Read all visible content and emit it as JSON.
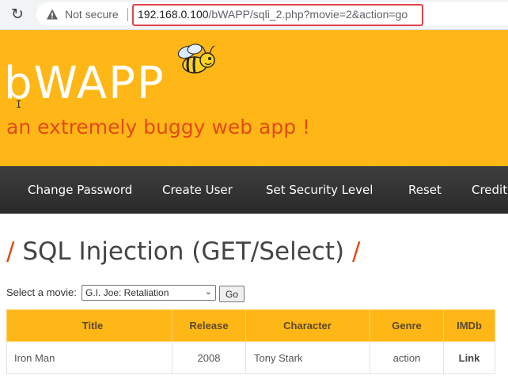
{
  "browser": {
    "not_secure": "Not secure",
    "url_host": "192.168.0.100",
    "url_path": "/bWAPP/sqli_2.php?movie=2&action=go"
  },
  "header": {
    "logo": "bWAPP",
    "tagline": "an extremely buggy web app !"
  },
  "nav": {
    "items": [
      "Change Password",
      "Create User",
      "Set Security Level",
      "Reset",
      "Credit"
    ]
  },
  "page": {
    "title": "SQL Injection (GET/Select)",
    "select_label": "Select a movie:",
    "selected_movie": "G.I. Joe: Retaliation",
    "go_label": "Go"
  },
  "table": {
    "headers": [
      "Title",
      "Release",
      "Character",
      "Genre",
      "IMDb"
    ],
    "rows": [
      [
        "Iron Man",
        "2008",
        "Tony Stark",
        "action",
        "Link"
      ]
    ]
  },
  "colors": {
    "header_bg": "#ffb717",
    "accent": "#e24a14",
    "nav_bg": "#2f2f2f",
    "url_highlight": "#e0444b"
  }
}
